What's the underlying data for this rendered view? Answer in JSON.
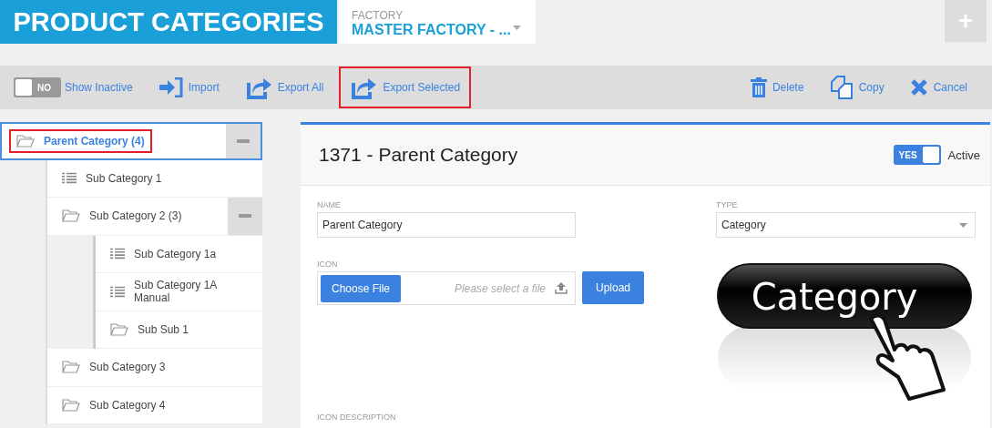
{
  "header": {
    "title": "PRODUCT CATEGORIES",
    "factory_label": "FACTORY",
    "factory_value": "MASTER FACTORY - ...",
    "add_button": "+"
  },
  "toolbar": {
    "show_inactive": {
      "on": false,
      "state_text": "NO",
      "label": "Show Inactive"
    },
    "left_actions": [
      {
        "kind": "import",
        "label": "Import",
        "highlighted": false
      },
      {
        "kind": "export",
        "label": "Export All",
        "highlighted": false
      },
      {
        "kind": "export",
        "label": "Export Selected",
        "highlighted": true
      }
    ],
    "right_actions": [
      {
        "kind": "delete",
        "label": "Delete"
      },
      {
        "kind": "copy",
        "label": "Copy"
      },
      {
        "kind": "cancel",
        "label": "Cancel"
      }
    ]
  },
  "tree": [
    {
      "label": "Parent Category (4)",
      "kind": "folder",
      "selected": true,
      "highlighted": true,
      "expanded": true,
      "children": [
        {
          "label": "Sub Category 1",
          "kind": "list",
          "selected": false,
          "highlighted": false
        },
        {
          "label": "Sub Category 2 (3)",
          "kind": "folder",
          "selected": false,
          "highlighted": false,
          "expanded": true,
          "children": [
            {
              "label": "Sub Category 1a",
              "kind": "list",
              "selected": false,
              "highlighted": false
            },
            {
              "label": "Sub Category 1A Manual",
              "kind": "list",
              "selected": false,
              "highlighted": false
            },
            {
              "label": "Sub Sub 1",
              "kind": "folder",
              "selected": false,
              "highlighted": false
            }
          ]
        },
        {
          "label": "Sub Category 3",
          "kind": "folder",
          "selected": false,
          "highlighted": false
        },
        {
          "label": "Sub Category 4",
          "kind": "folder",
          "selected": false,
          "highlighted": false
        }
      ]
    }
  ],
  "detail": {
    "title": "1371 - Parent Category",
    "active": {
      "on": true,
      "state_text": "YES",
      "label": "Active"
    },
    "name_label": "NAME",
    "name_value": "Parent Category",
    "type_label": "TYPE",
    "type_value": "Category",
    "icon_label": "ICON",
    "choose_file": "Choose File",
    "file_placeholder": "Please select a file",
    "upload": "Upload",
    "icon_preview": {
      "label": "Category"
    },
    "icon_description_label": "ICON DESCRIPTION"
  }
}
